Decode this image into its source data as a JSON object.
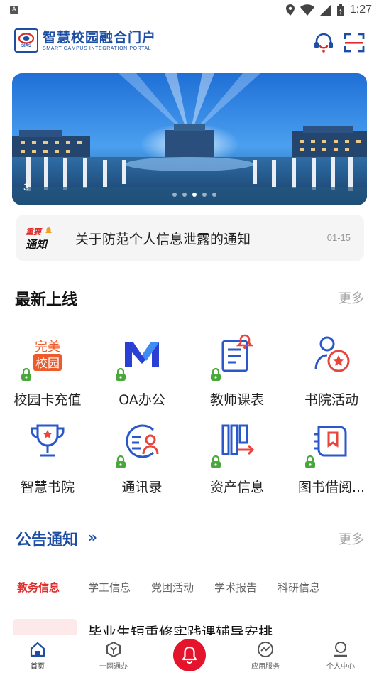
{
  "status_bar": {
    "time": "1:27",
    "left_indicator": "A"
  },
  "header": {
    "logo_badge_text": "SIAS",
    "title": "智慧校园融合门户",
    "subtitle": "SMART CAMPUS INTEGRATION PORTAL",
    "icons": [
      "headset-icon",
      "scan-icon"
    ]
  },
  "banner": {
    "index_label": "3",
    "dot_count": 5,
    "active_dot": 2
  },
  "notice": {
    "badge_top": "重要",
    "badge_bottom": "通知",
    "title": "关于防范个人信息泄露的通知",
    "date": "01-15"
  },
  "latest": {
    "title": "最新上线",
    "more": "更多",
    "apps": [
      {
        "label": "校园卡充值",
        "icon": "campus-card-icon",
        "locked": true
      },
      {
        "label": "OA办公",
        "icon": "oa-icon",
        "locked": true
      },
      {
        "label": "教师课表",
        "icon": "teacher-schedule-icon",
        "locked": true
      },
      {
        "label": "书院活动",
        "icon": "academy-activity-icon",
        "locked": false
      },
      {
        "label": "智慧书院",
        "icon": "trophy-icon",
        "locked": false
      },
      {
        "label": "通讯录",
        "icon": "contacts-icon",
        "locked": true
      },
      {
        "label": "资产信息",
        "icon": "asset-icon",
        "locked": true
      },
      {
        "label": "图书借阅...",
        "icon": "library-icon",
        "locked": true
      }
    ],
    "icon_bar_text": {
      "campus_card_top": "完美",
      "campus_card_bottom": "校园"
    }
  },
  "announcements": {
    "title": "公告通知",
    "chevron": "»",
    "more": "更多",
    "tabs": [
      "教务信息",
      "学工信息",
      "党团活动",
      "学术报告",
      "科研信息"
    ],
    "active_tab": 0,
    "first_item_title": "毕业生短重修实践课辅导安排"
  },
  "bottom_nav": {
    "items": [
      {
        "label": "首页",
        "icon": "home-icon",
        "active": true
      },
      {
        "label": "一网通办",
        "icon": "one-stop-icon",
        "active": false
      },
      {
        "label": "应用服务",
        "icon": "app-service-icon",
        "active": false
      },
      {
        "label": "个人中心",
        "icon": "profile-icon",
        "active": false
      }
    ],
    "center_icon": "bell-icon"
  },
  "colors": {
    "brand_blue": "#1d4ea4",
    "accent_red": "#e02b2b",
    "bell_red": "#e3142c",
    "lock_green": "#48a83a"
  }
}
